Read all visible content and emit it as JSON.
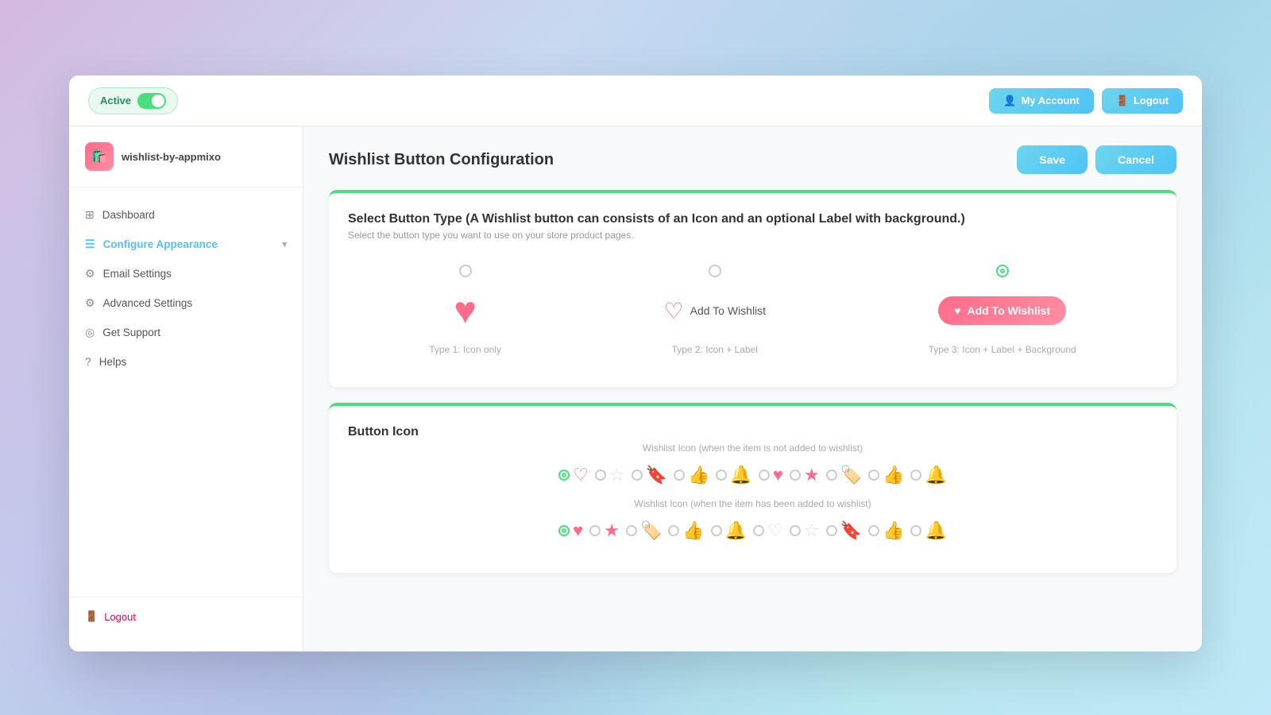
{
  "app": {
    "name": "wishlist-by-appmixo",
    "logo": "🛍️"
  },
  "topbar": {
    "active_label": "Active",
    "my_account_label": "My Account",
    "logout_label": "Logout"
  },
  "sidebar": {
    "items": [
      {
        "id": "dashboard",
        "label": "Dashboard",
        "icon": "⊞",
        "active": false
      },
      {
        "id": "configure-appearance",
        "label": "Configure Appearance",
        "icon": "☰",
        "active": true,
        "has_chevron": true
      },
      {
        "id": "email-settings",
        "label": "Email Settings",
        "icon": "⚙",
        "active": false
      },
      {
        "id": "advanced-settings",
        "label": "Advanced Settings",
        "icon": "⚙",
        "active": false
      },
      {
        "id": "get-support",
        "label": "Get Support",
        "icon": "◎",
        "active": false
      },
      {
        "id": "helps",
        "label": "Helps",
        "icon": "?",
        "active": false
      }
    ],
    "logout_label": "Logout"
  },
  "page": {
    "title": "Wishlist Button Configuration",
    "save_label": "Save",
    "cancel_label": "Cancel"
  },
  "button_type_section": {
    "title": "Select Button Type (A Wishlist button can consists of an Icon and an optional Label with background.)",
    "subtitle": "Select the button type you want to use on your store product pages.",
    "types": [
      {
        "id": "type1",
        "label": "Type 1: Icon only",
        "selected": false
      },
      {
        "id": "type2",
        "label": "Type 2: Icon + Label",
        "selected": false
      },
      {
        "id": "type3",
        "label": "Type 3: Icon + Label + Background",
        "selected": true
      }
    ],
    "add_to_wishlist": "Add To Wishlist"
  },
  "button_icon_section": {
    "title": "Button Icon",
    "not_added_label": "Wishlist Icon (when the item is not added to wishlist)",
    "added_label": "Wishlist Icon (when the item has been added to wishlist)",
    "not_added_icons": [
      {
        "id": "heart-outline",
        "selected": true
      },
      {
        "id": "star-outline",
        "selected": false
      },
      {
        "id": "bookmark-outline",
        "selected": false
      },
      {
        "id": "thumbsup-outline",
        "selected": false
      },
      {
        "id": "bell-outline",
        "selected": false
      },
      {
        "id": "heart-solid",
        "selected": false
      },
      {
        "id": "star-solid",
        "selected": false
      },
      {
        "id": "bookmark-solid",
        "selected": false
      },
      {
        "id": "thumbsup-solid",
        "selected": false
      },
      {
        "id": "bell-solid",
        "selected": false
      }
    ],
    "added_icons": [
      {
        "id": "heart-solid",
        "selected": true
      },
      {
        "id": "star-solid",
        "selected": false
      },
      {
        "id": "bookmark-solid",
        "selected": false
      },
      {
        "id": "thumbsup-solid",
        "selected": false
      },
      {
        "id": "bell-solid",
        "selected": false
      },
      {
        "id": "heart-outline",
        "selected": false
      },
      {
        "id": "star-outline",
        "selected": false
      },
      {
        "id": "bookmark-outline",
        "selected": false
      },
      {
        "id": "thumbsup-outline",
        "selected": false
      },
      {
        "id": "bell-outline",
        "selected": false
      }
    ]
  }
}
